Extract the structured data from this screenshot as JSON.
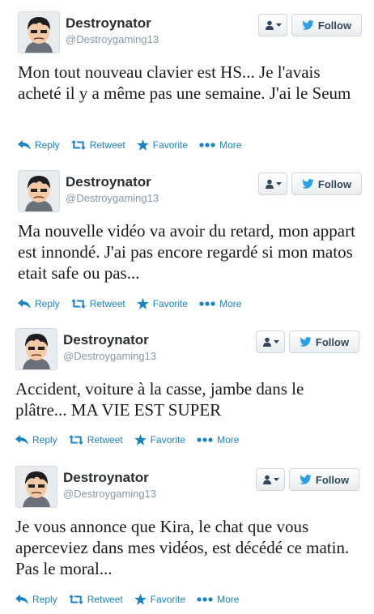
{
  "colors": {
    "link": "#1a83c3",
    "text": "#1b1b1b",
    "handle": "#8899a6",
    "twitter_bird": "#2c9fe5"
  },
  "icons": [
    "person-icon",
    "chevron-down-icon",
    "twitter-bird-icon",
    "reply-icon",
    "retweet-icon",
    "star-icon",
    "more-dots-icon"
  ],
  "tweets": [
    {
      "name": "Destroynator",
      "handle": "@Destroygaming13",
      "text": "Mon tout nouveau clavier est HS... Je l'avais acheté il y a même pas une semaine. J'ai le Seum",
      "follow_label": "Follow",
      "actions": {
        "reply": "Reply",
        "retweet": "Retweet",
        "favorite": "Favorite",
        "more": "More"
      }
    },
    {
      "name": "Destroynator",
      "handle": "@Destroygaming13",
      "text": "Ma nouvelle vidéo va avoir du retard, mon appart est innondé. J'ai pas encore regardé si mon matos etait safe ou pas...",
      "follow_label": "Follow",
      "actions": {
        "reply": "Reply",
        "retweet": "Retweet",
        "favorite": "Favorite",
        "more": "More"
      }
    },
    {
      "name": "Destroynator",
      "handle": "@Destroygaming13",
      "text": "Accident, voiture à la casse, jambe dans le plâtre... MA VIE EST SUPER",
      "follow_label": "Follow",
      "actions": {
        "reply": "Reply",
        "retweet": "Retweet",
        "favorite": "Favorite",
        "more": "More"
      }
    },
    {
      "name": "Destroynator",
      "handle": "@Destroygaming13",
      "text": "Je vous annonce que Kira, le chat que vous aperceviez dans mes vidéos, est décédé ce matin. Pas le moral...",
      "follow_label": "Follow",
      "actions": {
        "reply": "Reply",
        "retweet": "Retweet",
        "favorite": "Favorite",
        "more": "More"
      }
    }
  ]
}
